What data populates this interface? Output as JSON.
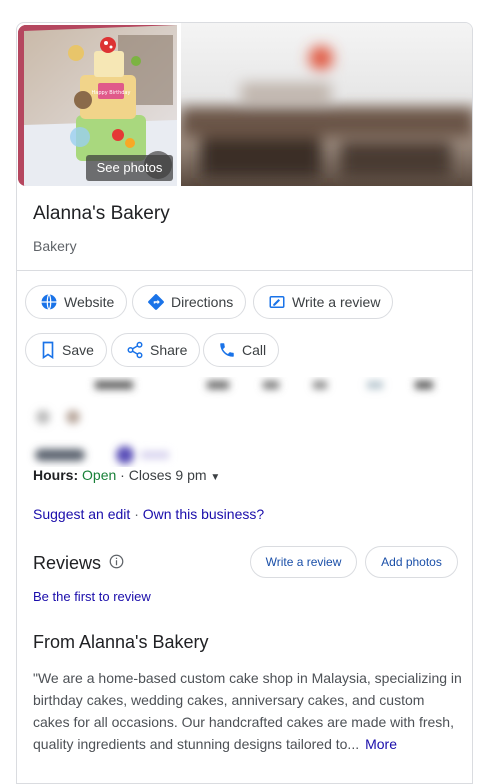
{
  "photos": {
    "see_photos_label": "See photos",
    "cake_topper_text": "Happy Birthday"
  },
  "business": {
    "name": "Alanna's Bakery",
    "category": "Bakery"
  },
  "actions": [
    {
      "label": "Website",
      "icon": "globe-icon"
    },
    {
      "label": "Directions",
      "icon": "directions-icon"
    },
    {
      "label": "Write a review",
      "icon": "write-review-icon"
    },
    {
      "label": "Save",
      "icon": "bookmark-icon"
    },
    {
      "label": "Share",
      "icon": "share-icon"
    },
    {
      "label": "Call",
      "icon": "phone-icon"
    }
  ],
  "hours": {
    "label": "Hours:",
    "status": "Open",
    "separator": "·",
    "closes": "Closes 9 pm"
  },
  "links": {
    "suggest_edit": "Suggest an edit",
    "separator": "·",
    "own_business": "Own this business?"
  },
  "reviews": {
    "title": "Reviews",
    "write_review": "Write a review",
    "add_photos": "Add photos",
    "first_review": "Be the first to review"
  },
  "from_business": {
    "title": "From Alanna's Bakery",
    "description": "\"We are a home-based custom cake shop in Malaysia, specializing in birthday cakes, wedding cakes, anniversary cakes, and custom cakes for all occasions. Our handcrafted cakes are made with fresh, quality ingredients and stunning designs tailored to...",
    "more": "More"
  },
  "colors": {
    "link_blue": "#1a0dab",
    "open_green": "#188038",
    "icon_blue": "#1a73e8",
    "photo_frame": "#b5475f"
  }
}
